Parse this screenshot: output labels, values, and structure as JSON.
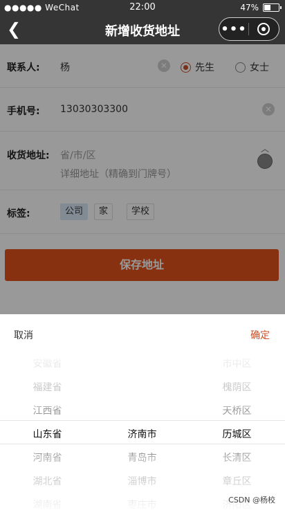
{
  "status_bar": {
    "carrier": "●●●●● WeChat",
    "time": "22:00",
    "battery_text": "47%",
    "battery_level": 0.47
  },
  "nav": {
    "back_icon": "chevron-left-icon",
    "title": "新增收货地址",
    "more_label": "•••"
  },
  "form": {
    "contact_label": "联系人:",
    "contact_value": "杨",
    "gender_options": [
      "先生",
      "女士"
    ],
    "gender_selected": "先生",
    "phone_label": "手机号:",
    "phone_value": "13030303300",
    "address_label": "收货地址:",
    "region_placeholder": "省/市/区",
    "detail_placeholder": "详细地址（精确到门牌号）",
    "tag_label": "标签:",
    "tags": [
      "公司",
      "家",
      "学校"
    ],
    "tag_selected": "公司",
    "save_label": "保存地址"
  },
  "picker": {
    "cancel_label": "取消",
    "confirm_label": "确定",
    "provinces": [
      "安徽省",
      "福建省",
      "江西省",
      "山东省",
      "河南省",
      "湖北省",
      "湖南省"
    ],
    "cities": [
      "济南市",
      "青岛市",
      "淄博市",
      "枣庄市"
    ],
    "districts": [
      "市中区",
      "槐荫区",
      "天桥区",
      "历城区",
      "长清区",
      "章丘区",
      "济阳区"
    ],
    "selected": {
      "province": "山东省",
      "city": "济南市",
      "district": "历城区"
    }
  },
  "watermark": "CSDN @杨校",
  "colors": {
    "accent": "#c9502a",
    "button": "#e1531c",
    "navbar": "#353535"
  }
}
